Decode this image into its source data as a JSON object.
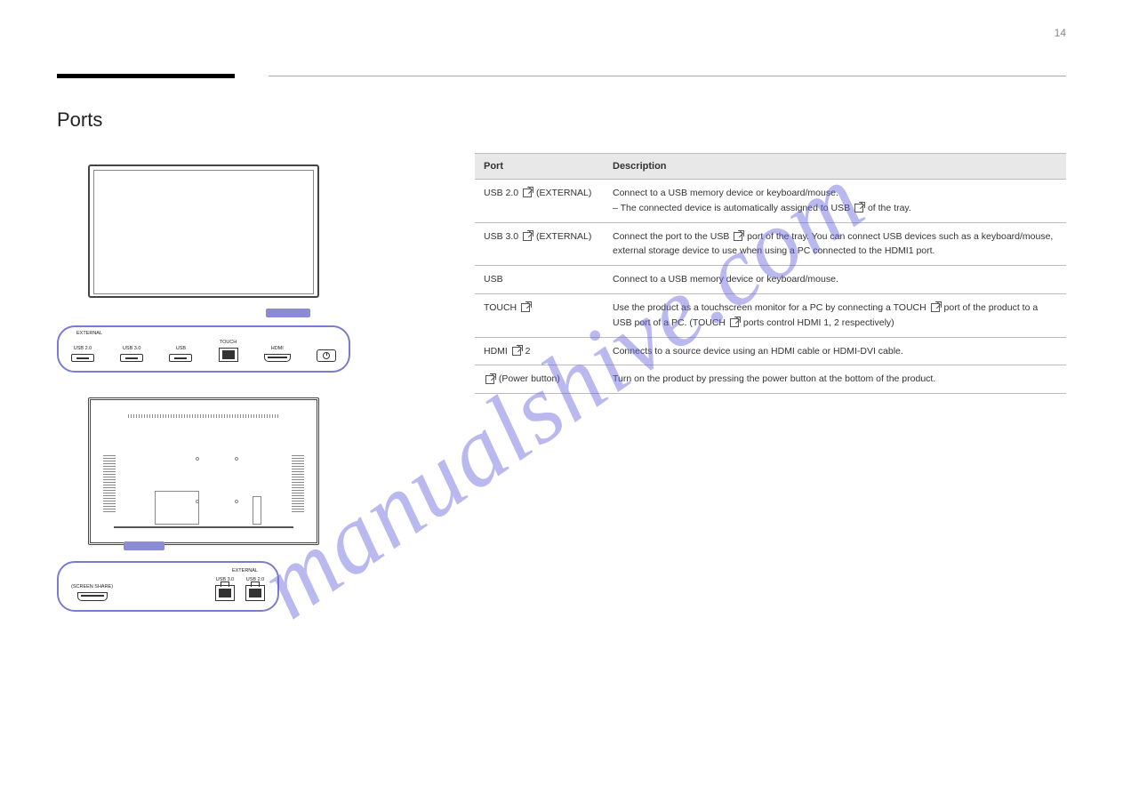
{
  "page_number": "14",
  "section_title": "Ports",
  "watermark": "manualshive.com",
  "front_panel": {
    "group_label": "EXTERNAL",
    "ports": [
      "USB 2.0",
      "USB 3.0",
      "USB",
      "TOUCH",
      "HDMI",
      ""
    ]
  },
  "rear_panel": {
    "left_label": "(SCREEN SHARE)",
    "group_label": "EXTERNAL",
    "ports": [
      "USB 3.0",
      "USB 2.0"
    ]
  },
  "table": {
    "headers": [
      "Port",
      "Description"
    ],
    "rows": [
      {
        "port_pre": "USB 2.0 ",
        "port_post": " (EXTERNAL)",
        "desc_parts": [
          "Connect to a USB memory device or keyboard/mouse.",
          " ",
          "– The connected device is automatically assigned to USB ",
          " of the tray."
        ]
      },
      {
        "port_pre": "USB 3.0 ",
        "port_post": " (EXTERNAL)",
        "desc_parts": [
          "Connect the port to the USB ",
          " port of the tray. You can connect USB devices such as a keyboard/mouse, external storage device to use when using a PC connected to the HDMI1 port."
        ]
      },
      {
        "port_pre": "USB ",
        "port_post": "",
        "desc_parts": [
          "Connect to a USB memory device or keyboard/mouse."
        ]
      },
      {
        "port_pre": "TOUCH ",
        "port_post": "",
        "desc_parts": [
          "Use the product as a touchscreen monitor for a PC by connecting a TOUCH ",
          " port of the product to a USB port of a PC. (TOUCH ",
          " ports control HDMI 1, 2 respectively)"
        ]
      },
      {
        "port_pre": "HDMI ",
        "port_post": " 2",
        "desc_parts": [
          "Connects to a source device using an HDMI cable or HDMI-DVI cable."
        ]
      },
      {
        "port_pre": "",
        "port_post": " (Power button)",
        "desc_parts": [
          "Turn on the product by pressing the power button at the bottom of the product."
        ]
      }
    ]
  }
}
